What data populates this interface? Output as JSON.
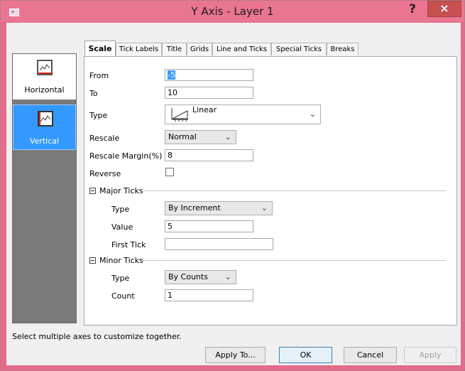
{
  "window": {
    "title": "Y Axis - Layer 1",
    "help": "?",
    "close": "×"
  },
  "sidebar": {
    "items": [
      {
        "label": "Horizontal",
        "selected": false
      },
      {
        "label": "Vertical",
        "selected": true
      }
    ]
  },
  "tabs": [
    "Scale",
    "Tick Labels",
    "Title",
    "Grids",
    "Line and Ticks",
    "Special Ticks",
    "Breaks"
  ],
  "active_tab": "Scale",
  "scale": {
    "from_label": "From",
    "from_value": "-5",
    "to_label": "To",
    "to_value": "10",
    "type_label": "Type",
    "type_value": "Linear",
    "rescale_label": "Rescale",
    "rescale_value": "Normal",
    "margin_label": "Rescale Margin(%)",
    "margin_value": "8",
    "reverse_label": "Reverse",
    "reverse_checked": false
  },
  "major_ticks": {
    "header": "Major Ticks",
    "type_label": "Type",
    "type_value": "By Increment",
    "value_label": "Value",
    "value_value": "5",
    "first_label": "First Tick",
    "first_value": ""
  },
  "minor_ticks": {
    "header": "Minor Ticks",
    "type_label": "Type",
    "type_value": "By Counts",
    "count_label": "Count",
    "count_value": "1"
  },
  "status_text": "Select multiple axes to customize together.",
  "buttons": {
    "apply_to": "Apply To...",
    "ok": "OK",
    "cancel": "Cancel",
    "apply": "Apply"
  },
  "colors": {
    "titlebar": "#ea7591",
    "close": "#c75050",
    "selection": "#3399ff"
  }
}
